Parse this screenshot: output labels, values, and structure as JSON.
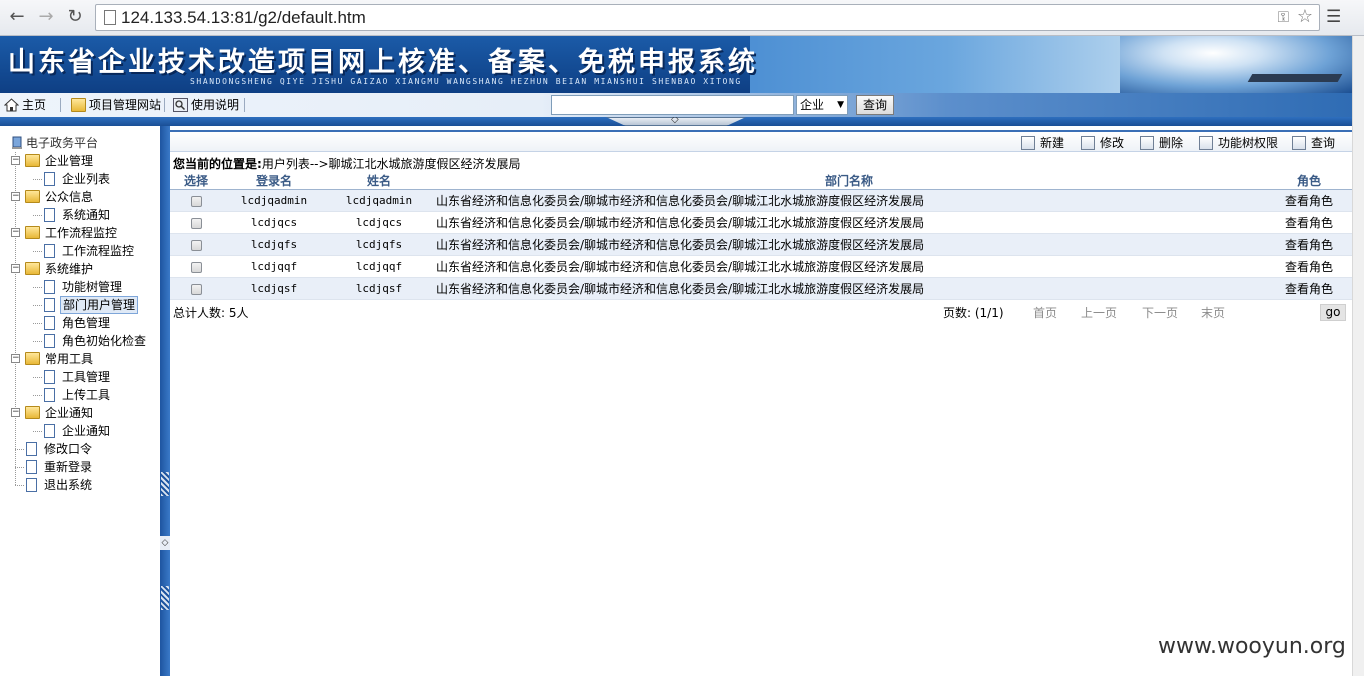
{
  "browser": {
    "url": "124.133.54.13:81/g2/default.htm"
  },
  "banner": {
    "title": "山东省企业技术改造项目网上核准、备案、免税申报系统",
    "subtitle": "SHANDONGSHENG QIYE JISHU GAIZAO XIANGMU WANGSHANG HEZHUN BEIAN MIANSHUI SHENBAO XITONG"
  },
  "toolbar": {
    "home": "主页",
    "project_site": "项目管理网站",
    "help": "使用说明",
    "search_value": "",
    "search_type": "企业",
    "search_button": "查询"
  },
  "tree": {
    "root": "电子政务平台",
    "nodes": [
      {
        "label": "企业管理",
        "children": [
          "企业列表"
        ]
      },
      {
        "label": "公众信息",
        "children": [
          "系统通知"
        ]
      },
      {
        "label": "工作流程监控",
        "children": [
          "工作流程监控"
        ]
      },
      {
        "label": "系统维护",
        "children": [
          "功能树管理",
          "部门用户管理",
          "角色管理",
          "角色初始化检查"
        ]
      },
      {
        "label": "常用工具",
        "children": [
          "工具管理",
          "上传工具"
        ]
      },
      {
        "label": "企业通知",
        "children": [
          "企业通知"
        ]
      }
    ],
    "leaves": [
      "修改口令",
      "重新登录",
      "退出系统"
    ],
    "selected": "部门用户管理"
  },
  "main_toolbar": {
    "new": "新建",
    "edit": "修改",
    "delete": "删除",
    "permissions": "功能树权限",
    "query": "查询"
  },
  "breadcrumb": {
    "prefix": "您当前的位置是:",
    "path": "用户列表-->聊城江北水城旅游度假区经济发展局"
  },
  "table": {
    "headers": {
      "select": "选择",
      "login": "登录名",
      "name": "姓名",
      "dept": "部门名称",
      "role": "角色"
    },
    "rows": [
      {
        "login": "lcdjqadmin",
        "name": "lcdjqadmin",
        "dept": "山东省经济和信息化委员会/聊城市经济和信息化委员会/聊城江北水城旅游度假区经济发展局",
        "role": "查看角色"
      },
      {
        "login": "lcdjqcs",
        "name": "lcdjqcs",
        "dept": "山东省经济和信息化委员会/聊城市经济和信息化委员会/聊城江北水城旅游度假区经济发展局",
        "role": "查看角色"
      },
      {
        "login": "lcdjqfs",
        "name": "lcdjqfs",
        "dept": "山东省经济和信息化委员会/聊城市经济和信息化委员会/聊城江北水城旅游度假区经济发展局",
        "role": "查看角色"
      },
      {
        "login": "lcdjqqf",
        "name": "lcdjqqf",
        "dept": "山东省经济和信息化委员会/聊城市经济和信息化委员会/聊城江北水城旅游度假区经济发展局",
        "role": "查看角色"
      },
      {
        "login": "lcdjqsf",
        "name": "lcdjqsf",
        "dept": "山东省经济和信息化委员会/聊城市经济和信息化委员会/聊城江北水城旅游度假区经济发展局",
        "role": "查看角色"
      }
    ]
  },
  "pagination": {
    "total": "总计人数: 5人",
    "pages": "页数: (1/1)",
    "first": "首页",
    "prev": "上一页",
    "next": "下一页",
    "last": "末页",
    "go": "go"
  },
  "watermark": "www.wooyun.org",
  "colors": {
    "accent": "#1d5fae",
    "header_text": "#3b5b86",
    "row_alt": "#e9eff8"
  }
}
